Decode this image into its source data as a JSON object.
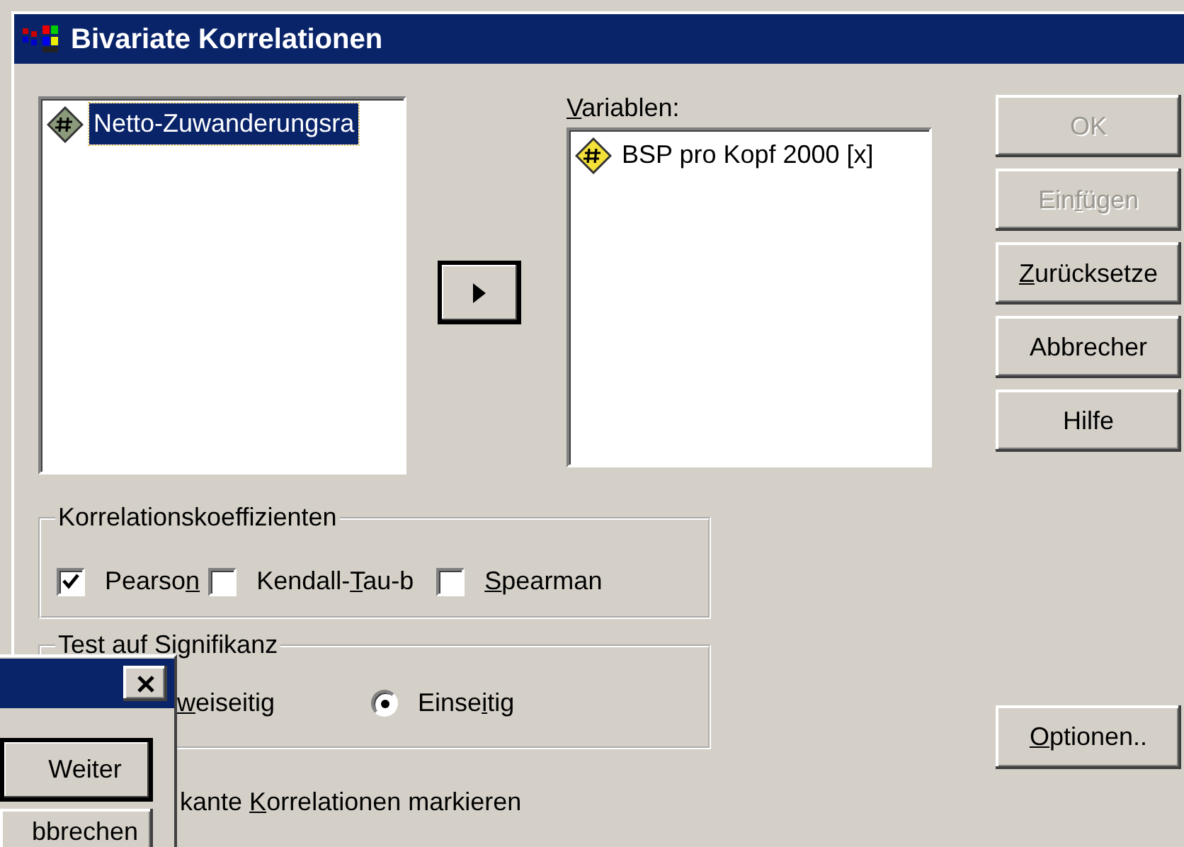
{
  "main_dialog": {
    "title": "Bivariate Korrelationen",
    "source_list": {
      "items": [
        {
          "label": "Netto-Zuwanderungsra",
          "selected": true,
          "color": "#8a9a7a"
        }
      ]
    },
    "variables_label": {
      "key": "V",
      "after": "ariablen:"
    },
    "variables_list": {
      "items": [
        {
          "label": "BSP pro Kopf 2000 [x]",
          "selected": false,
          "color": "#f4e23a"
        }
      ]
    },
    "buttons": [
      {
        "label": "OK",
        "disabled": true
      },
      {
        "before": "Ein",
        "key": "f",
        "after": "ügen",
        "disabled": true
      },
      {
        "key": "Z",
        "after": "urücksetze",
        "disabled": false
      },
      {
        "label": "Abbrecher",
        "disabled": false
      },
      {
        "label": "Hilfe",
        "disabled": false
      }
    ],
    "coefficients": {
      "title": "Korrelationskoeffizienten",
      "options": [
        {
          "before": "Pearso",
          "key": "n",
          "checked": true
        },
        {
          "before": "Kendall-",
          "key": "T",
          "after": "au-b",
          "checked": false
        },
        {
          "key": "S",
          "after": "pearman",
          "checked": false
        }
      ]
    },
    "significance": {
      "title": "Test auf Signifikanz",
      "options": [
        {
          "kind": "text",
          "key": "w",
          "after": "eiseitig"
        },
        {
          "kind": "radio",
          "before": "Einse",
          "key": "i",
          "after": "tig",
          "selected": true
        }
      ]
    },
    "flag_label": {
      "before": "kante ",
      "key": "K",
      "after": "orrelationen markieren"
    },
    "options_button": {
      "key": "O",
      "after": "ptionen.."
    }
  },
  "sub_dialog": {
    "buttons": [
      {
        "label": "Weiter",
        "default": true
      },
      {
        "label": "bbrechen",
        "default": false
      }
    ]
  }
}
